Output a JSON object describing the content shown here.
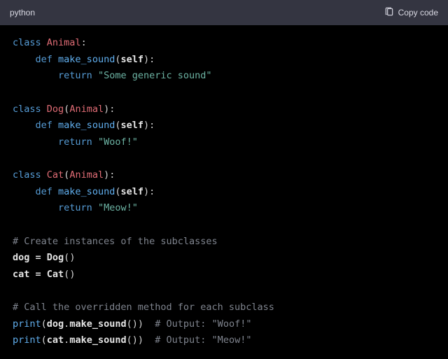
{
  "header": {
    "language": "python",
    "copy_label": "Copy code"
  },
  "code": {
    "class_kw": "class",
    "def_kw": "def",
    "return_kw": "return",
    "self_kw": "self",
    "animal_cls": "Animal",
    "dog_cls": "Dog",
    "cat_cls": "Cat",
    "method": "make_sound",
    "str_generic": "\"Some generic sound\"",
    "str_woof": "\"Woof!\"",
    "str_meow": "\"Meow!\"",
    "cmt_instances": "# Create instances of the subclasses",
    "cmt_override": "# Call the overridden method for each subclass",
    "dog_var": "dog",
    "cat_var": "cat",
    "eq": " = ",
    "print_fn": "print",
    "cmt_out_woof": "# Output: \"Woof!\"",
    "cmt_out_meow": "# Output: \"Meow!\"",
    "colon": ":",
    "lpar": "(",
    "rpar": ")",
    "dot": "."
  }
}
